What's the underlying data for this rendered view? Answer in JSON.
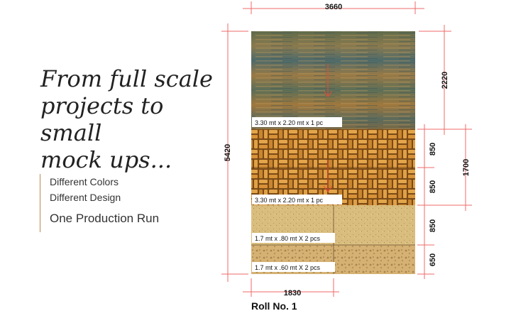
{
  "headline": {
    "line1": "From full scale",
    "line2": "projects to small",
    "line3": "mock ups..."
  },
  "features": [
    "Different Colors",
    "Different Design",
    "One Production Run"
  ],
  "dimensions": {
    "top_width": "3660",
    "total_height": "5420",
    "section1_height": "2220",
    "section2a_height": "850",
    "section2b_height": "850",
    "section2_total": "1700",
    "section3_height": "850",
    "section4_height": "650",
    "bottom_width": "1830"
  },
  "sections": [
    {
      "label": "3.30 mt x 2.20 mt x 1 pc"
    },
    {
      "label": "3.30 mt x 2.20 mt x 1 pc"
    },
    {
      "label": "1.7 mt x .80 mt X 2 pcs"
    },
    {
      "label": "1.7 mt x .60 mt X 2 pcs"
    }
  ],
  "roll_label": "Roll No. 1",
  "colors": {
    "dimension_line": "#f06a6a",
    "border_accent": "#b8895a"
  }
}
